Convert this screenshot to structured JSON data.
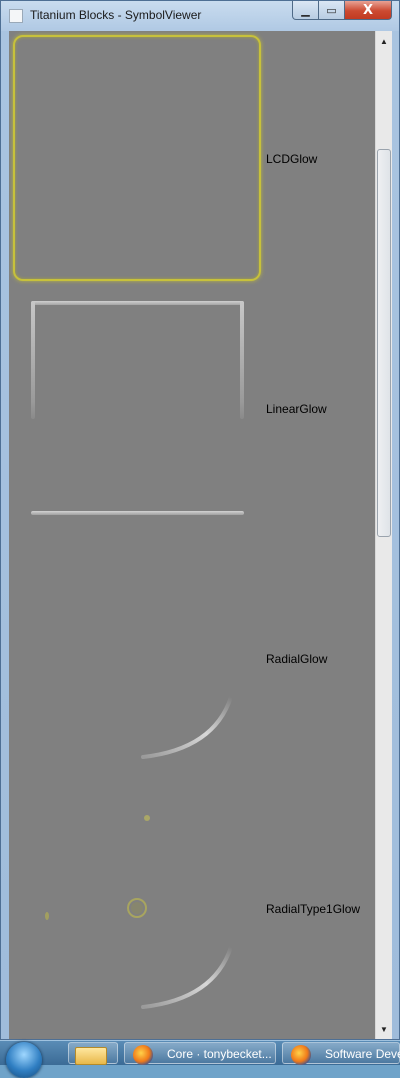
{
  "window": {
    "title": "Titanium Blocks - SymbolViewer",
    "minimize_glyph": "▁",
    "maximize_glyph": "▭",
    "close_glyph": "X"
  },
  "symbols": [
    {
      "label": "LCDGlow"
    },
    {
      "label": "LinearGlow"
    },
    {
      "label": "RadialGlow"
    },
    {
      "label": "RadialType1Glow"
    }
  ],
  "scrollbar": {
    "up_glyph": "▲",
    "down_glyph": "▼"
  },
  "taskbar": {
    "items": [
      {
        "label": "",
        "icon": "folder-icon"
      },
      {
        "label": "Core · tonybecket...",
        "icon": "firefox-icon"
      },
      {
        "label": "Software Deve",
        "icon": "firefox-icon"
      }
    ]
  },
  "colors": {
    "canvas": "#808080",
    "glow_yellow": "#c7c13b",
    "glow_silver": "#c8c8c8"
  }
}
